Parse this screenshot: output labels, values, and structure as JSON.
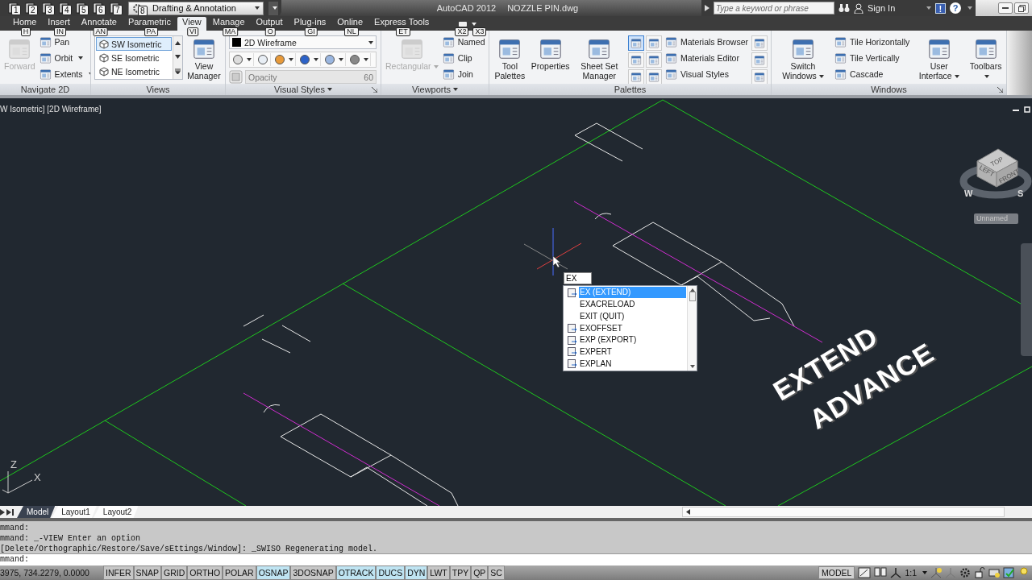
{
  "title_bar": {
    "quick_access": [
      {
        "keytip": "1"
      },
      {
        "keytip": "2"
      },
      {
        "keytip": "3"
      },
      {
        "keytip": "4"
      },
      {
        "keytip": "5"
      },
      {
        "keytip": "6"
      },
      {
        "keytip": "7"
      }
    ],
    "workspace": {
      "value": "Drafting & Annotation",
      "keytip": "8"
    },
    "app_title": "AutoCAD 2012",
    "file_name": "NOZZLE PIN.dwg",
    "search_placeholder": "Type a keyword or phrase",
    "sign_in": "Sign In",
    "exchange": "!",
    "help": "?"
  },
  "ribbon_tabs": [
    {
      "label": "Home",
      "keytip": "H",
      "selected": false
    },
    {
      "label": "Insert",
      "keytip": "IN",
      "selected": false
    },
    {
      "label": "Annotate",
      "keytip": "AN",
      "selected": false
    },
    {
      "label": "Parametric",
      "keytip": "PA",
      "selected": false
    },
    {
      "label": "View",
      "keytip": "VI",
      "selected": true
    },
    {
      "label": "Manage",
      "keytip": "MA",
      "selected": false
    },
    {
      "label": "Output",
      "keytip": "O",
      "selected": false
    },
    {
      "label": "Plug-ins",
      "keytip": "GI",
      "selected": false
    },
    {
      "label": "Online",
      "keytip": "NL",
      "selected": false
    },
    {
      "label": "Express Tools",
      "keytip": "ET",
      "selected": false
    }
  ],
  "overflow_keytips": [
    "X2",
    "X3"
  ],
  "ribbon_panels": [
    {
      "title": "Navigate 2D",
      "title_dropdown": false,
      "launcher": false,
      "items": [
        {
          "kind": "large",
          "label": "Forward",
          "disabled": true,
          "dropdown": false
        },
        {
          "kind": "stack",
          "items": [
            {
              "label": "Pan",
              "dropdown": false
            },
            {
              "label": "Orbit",
              "dropdown": true
            },
            {
              "label": "Extents",
              "dropdown": true
            }
          ]
        }
      ]
    },
    {
      "title": "Views",
      "title_dropdown": false,
      "launcher": false,
      "items": [
        {
          "kind": "list",
          "entries": [
            {
              "label": "SW Isometric",
              "selected": true
            },
            {
              "label": "SE Isometric",
              "selected": false
            },
            {
              "label": "NE Isometric",
              "selected": false
            }
          ]
        },
        {
          "kind": "large",
          "label": "View Manager",
          "disabled": false,
          "dropdown": false
        }
      ]
    },
    {
      "title": "Visual Styles",
      "title_dropdown": true,
      "launcher": true,
      "items": [
        {
          "kind": "style_tools",
          "style": "2D Wireframe",
          "slider_label": "Opacity",
          "slider_value": "60",
          "slider_disabled": true
        }
      ]
    },
    {
      "title": "Viewports",
      "title_dropdown": true,
      "launcher": false,
      "items": [
        {
          "kind": "large",
          "label": "Rectangular",
          "disabled": true,
          "dropdown": true
        },
        {
          "kind": "stack",
          "items": [
            {
              "label": "Named",
              "dropdown": false
            },
            {
              "label": "Clip",
              "dropdown": false
            },
            {
              "label": "Join",
              "dropdown": false
            }
          ]
        }
      ]
    },
    {
      "title": "Palettes",
      "title_dropdown": false,
      "launcher": false,
      "items": [
        {
          "kind": "large",
          "label": "Tool Palettes",
          "disabled": false,
          "dropdown": false
        },
        {
          "kind": "large",
          "label": "Properties",
          "disabled": false,
          "dropdown": false
        },
        {
          "kind": "large",
          "label": "Sheet Set Manager",
          "disabled": false,
          "dropdown": false
        },
        {
          "kind": "icon_grid",
          "toggles": [
            {
              "on": true
            },
            {
              "on": false
            },
            {
              "on": false
            },
            {
              "on": false
            },
            {
              "on": false
            },
            {
              "on": false
            }
          ]
        },
        {
          "kind": "stack",
          "items": [
            {
              "label": "Materials Browser",
              "dropdown": false
            },
            {
              "label": "Materials Editor",
              "dropdown": false
            },
            {
              "label": "Visual Styles",
              "dropdown": false
            }
          ]
        },
        {
          "kind": "icon_column",
          "toggles": [
            {
              "on": false
            },
            {
              "on": false
            },
            {
              "on": false
            }
          ]
        }
      ]
    },
    {
      "title": "Windows",
      "title_dropdown": false,
      "launcher": true,
      "items": [
        {
          "kind": "large",
          "label": "Switch Windows",
          "disabled": false,
          "dropdown": true
        },
        {
          "kind": "stack",
          "items": [
            {
              "label": "Tile Horizontally",
              "dropdown": false
            },
            {
              "label": "Tile Vertically",
              "dropdown": false
            },
            {
              "label": "Cascade",
              "dropdown": false
            }
          ]
        },
        {
          "kind": "large",
          "label": "User Interface",
          "disabled": false,
          "dropdown": true
        },
        {
          "kind": "large",
          "label": "Toolbars",
          "disabled": false,
          "dropdown": true
        }
      ]
    }
  ],
  "viewport": {
    "label": "W Isometric] [2D Wireframe]",
    "dynamic_input": "EX",
    "autocomplete": [
      {
        "label": "EX (EXTEND)",
        "selected": true,
        "has_icon": true
      },
      {
        "label": "EXACRELOAD",
        "selected": false,
        "has_icon": false
      },
      {
        "label": "EXIT (QUIT)",
        "selected": false,
        "has_icon": false
      },
      {
        "label": "EXOFFSET",
        "selected": false,
        "has_icon": true
      },
      {
        "label": "EXP (EXPORT)",
        "selected": false,
        "has_icon": true
      },
      {
        "label": "EXPERT",
        "selected": false,
        "has_icon": true
      },
      {
        "label": "EXPLAN",
        "selected": false,
        "has_icon": true
      }
    ],
    "drawing_text": [
      "EXTEND",
      "ADVANCE"
    ],
    "viewcube": {
      "faces": [
        "TOP",
        "LEFT",
        "FRONT"
      ],
      "compass": [
        "W",
        "S"
      ],
      "ucs_menu": "Unnamed"
    },
    "ucs_axes": [
      "Z",
      "X"
    ]
  },
  "layout_tabs": [
    {
      "label": "Model",
      "selected": true
    },
    {
      "label": "Layout1",
      "selected": false
    },
    {
      "label": "Layout2",
      "selected": false
    }
  ],
  "command_history": [
    "mmand:",
    "mmand: _-VIEW Enter an option",
    "[Delete/Orthographic/Restore/Save/sEttings/Window]: _SWISO Regenerating model."
  ],
  "command_prompt": "mmand:",
  "status_bar": {
    "coordinates": "3975, 734.2279, 0.0000",
    "toggles": [
      {
        "label": "INFER",
        "on": false
      },
      {
        "label": "SNAP",
        "on": false
      },
      {
        "label": "GRID",
        "on": false
      },
      {
        "label": "ORTHO",
        "on": false
      },
      {
        "label": "POLAR",
        "on": false
      },
      {
        "label": "OSNAP",
        "on": true
      },
      {
        "label": "3DOSNAP",
        "on": false
      },
      {
        "label": "OTRACK",
        "on": true
      },
      {
        "label": "DUCS",
        "on": true
      },
      {
        "label": "DYN",
        "on": true
      },
      {
        "label": "LWT",
        "on": false
      },
      {
        "label": "TPY",
        "on": false
      },
      {
        "label": "QP",
        "on": false
      },
      {
        "label": "SC",
        "on": false
      }
    ],
    "space": "MODEL",
    "scale": "1:1"
  }
}
